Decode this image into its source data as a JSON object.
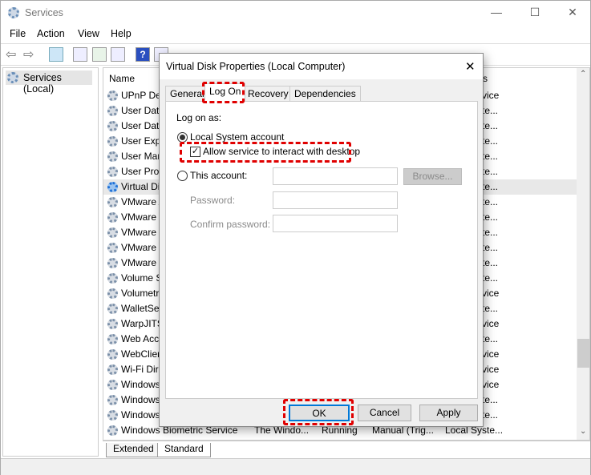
{
  "window": {
    "title": "Services",
    "controls": {
      "minimize": "—",
      "maximize": "☐",
      "close": "✕"
    }
  },
  "menu": [
    "File",
    "Action",
    "View",
    "Help"
  ],
  "left_pane": {
    "root": "Services (Local)"
  },
  "list": {
    "header_name": "Name",
    "header_right": "s",
    "rows": [
      {
        "name": "UPnP Dev",
        "right": "vice"
      },
      {
        "name": "User Data",
        "right": "te..."
      },
      {
        "name": "User Data",
        "right": "te..."
      },
      {
        "name": "User Expe",
        "right": "te..."
      },
      {
        "name": "User Man",
        "right": "te..."
      },
      {
        "name": "User Prof",
        "right": "te..."
      },
      {
        "name": "Virtual Di",
        "right": "te...",
        "selected": true
      },
      {
        "name": "VMware A",
        "right": "te..."
      },
      {
        "name": "VMware I",
        "right": "te..."
      },
      {
        "name": "VMware I",
        "right": "te..."
      },
      {
        "name": "VMware I",
        "right": "te..."
      },
      {
        "name": "VMware V",
        "right": "te..."
      },
      {
        "name": "Volume S",
        "right": "te..."
      },
      {
        "name": "Volumetr",
        "right": "vice"
      },
      {
        "name": "WalletSer",
        "right": "te..."
      },
      {
        "name": "WarpJITS",
        "right": "vice"
      },
      {
        "name": "Web Acc",
        "right": "te..."
      },
      {
        "name": "WebClien",
        "right": "vice"
      },
      {
        "name": "Wi-Fi Dir",
        "right": "vice"
      },
      {
        "name": "Windows",
        "right": "vice"
      },
      {
        "name": "Windows",
        "right": "te..."
      },
      {
        "name": "Windows",
        "right": "te..."
      }
    ],
    "last_row": {
      "name": "Windows Biometric Service",
      "description": "The Windo...",
      "status": "Running",
      "startup": "Manual (Trig...",
      "logon": "Local Syste..."
    }
  },
  "bottom_tabs": [
    "Extended",
    "Standard"
  ],
  "dialog": {
    "title": "Virtual Disk Properties (Local Computer)",
    "close": "✕",
    "tabs": [
      "General",
      "Log On",
      "Recovery",
      "Dependencies"
    ],
    "active_tab": "Log On",
    "logon_as": "Log on as:",
    "local_system": "Local System account",
    "allow_interact": "Allow service to interact with desktop",
    "allow_checked": true,
    "this_account": "This account:",
    "browse": "Browse...",
    "password": "Password:",
    "confirm_password": "Confirm password:",
    "ok": "OK",
    "cancel": "Cancel",
    "apply": "Apply"
  },
  "colors": {
    "highlight": "#e00000",
    "focus": "#0078d7"
  }
}
